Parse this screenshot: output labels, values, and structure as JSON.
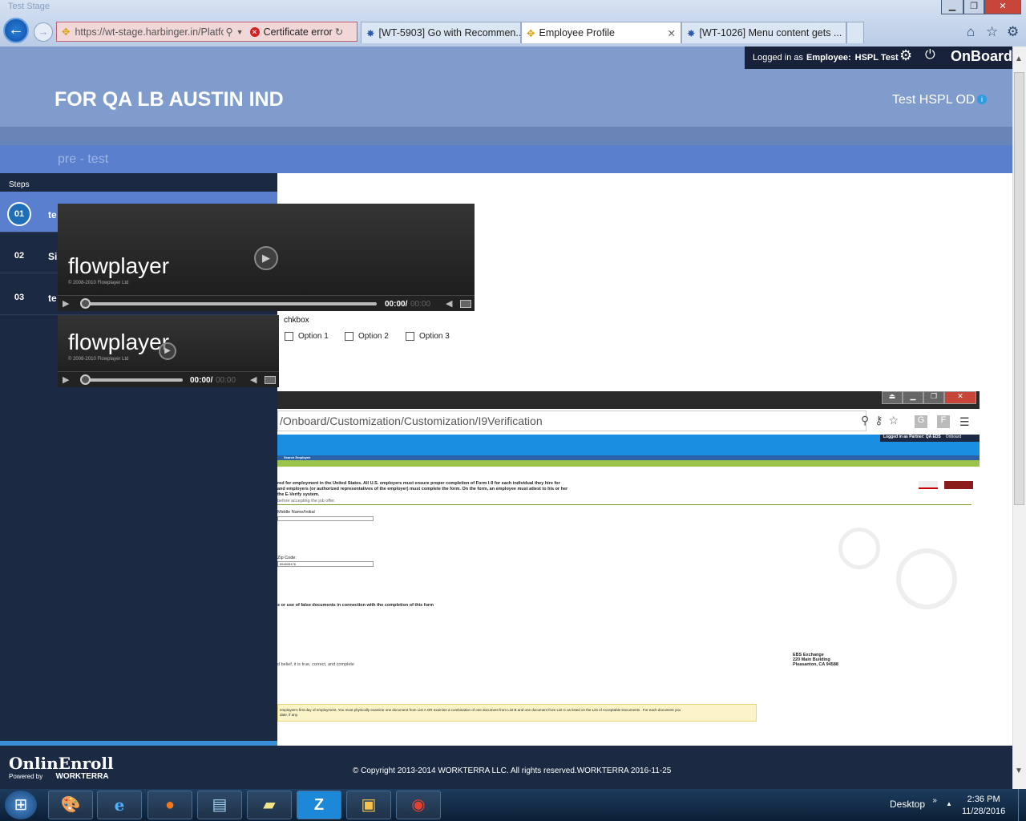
{
  "browser": {
    "window_title": "Test Stage",
    "address": "https://wt-stage.harbinger.in/Platfo",
    "cert_error": "Certificate error",
    "tabs": [
      {
        "label": "[WT-5903] Go with Recommen..."
      },
      {
        "label": "Employee Profile"
      },
      {
        "label": "[WT-1026] Menu content gets ..."
      }
    ]
  },
  "header": {
    "logged_in_prefix": "Logged in as",
    "role": "Employee:",
    "user_name": "HSPL Test",
    "brand": "OnBoard",
    "company": "FOR QA LB AUSTIN IND",
    "employee": "Test HSPL OD",
    "subtitle": "pre - test"
  },
  "sidebar": {
    "title": "Steps",
    "steps": [
      {
        "num": "01",
        "name": "te"
      },
      {
        "num": "02",
        "name": "Si"
      },
      {
        "num": "03",
        "name": "te"
      }
    ]
  },
  "players": [
    {
      "logo": "flowplayer",
      "copyright": "© 2008-2010 Flowplayer Ltd",
      "time": "00:00/",
      "duration": "00:00"
    },
    {
      "logo": "flowplayer",
      "copyright": "© 2008-2010 Flowplayer Ltd",
      "time": "00:00/",
      "duration": "00:00"
    }
  ],
  "form": {
    "chk_label": "chkbox",
    "options": [
      "Option 1",
      "Option 2",
      "Option 3"
    ]
  },
  "embedded": {
    "url": "/Onboard/Customization/Customization/I9Verification",
    "logged_in": "Logged in as Partner:  QA EDS",
    "brand": "Onboard",
    "nav": "Search Employee",
    "line1": "red for employment in the United States. All U.S. employers must ensure proper completion of Form I-9 for each individual they hire for",
    "line2": "and employers (or authorized representatives of the employer) must complete the form. On the form, an employee must attest to his or her",
    "line3": "the E-Verify system.",
    "line4": "before accepting the job offer.",
    "middle_name": "Middle Name/Initial",
    "zip_label": "Zip Code:",
    "zip_value": "654535476",
    "warning": "s or use of false documents in connection with the completion of this form",
    "belief": "d belief, it is true, correct, and complete",
    "address_lines": [
      "EBS Exchange",
      "220 Main Building",
      "Pleasanton, CA  94588"
    ],
    "notice": "employee's first day of employment. You must physically examine one document from List A OR examine a combination of one document from List B and one document from List C as listed on the List of Acceptable Documents . For each document you",
    "notice2": "date, if any."
  },
  "footer": {
    "logo": "OnlinEnroll",
    "powered": "Powered by",
    "powered_brand": "WORKTERRA",
    "copyright": "© Copyright 2013-2014 WORKTERRA LLC. All rights reserved.WORKTERRA 2016-11-25"
  },
  "taskbar": {
    "desktop": "Desktop",
    "time": "2:36 PM",
    "date": "11/28/2016"
  }
}
